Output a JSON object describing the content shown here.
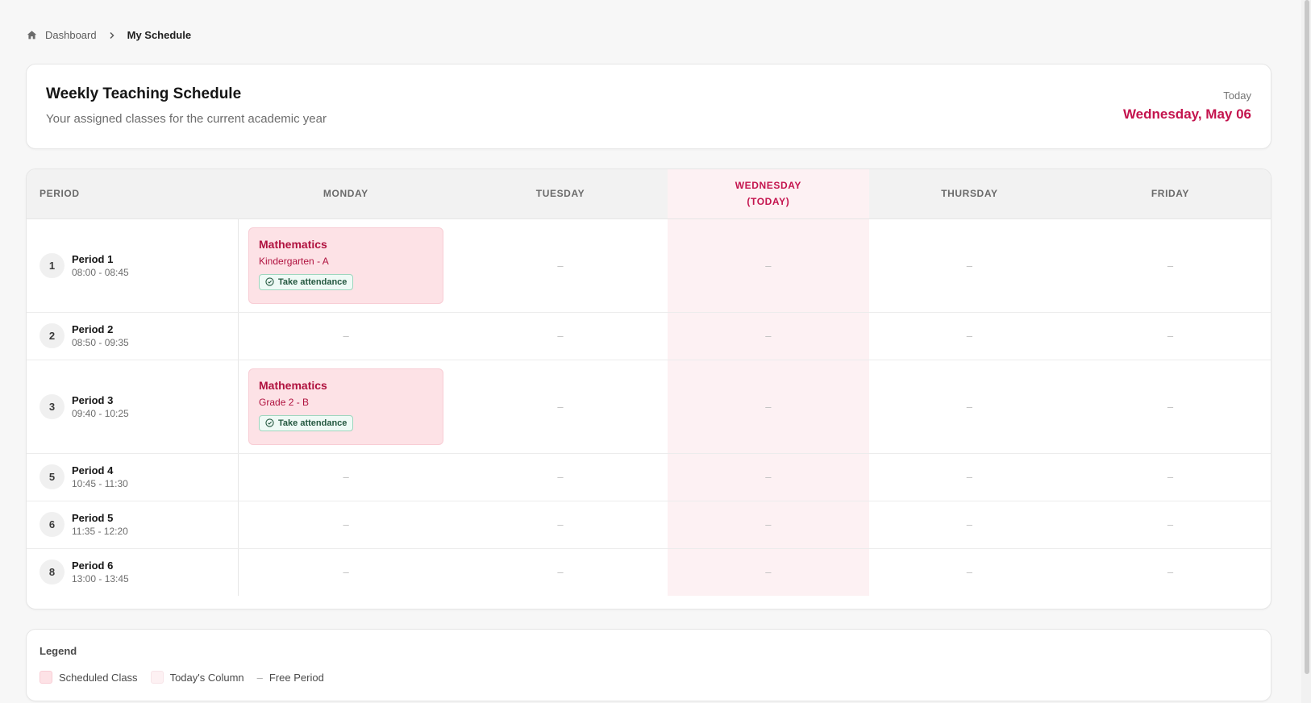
{
  "breadcrumb": {
    "home_label": "Dashboard",
    "current": "My Schedule"
  },
  "header": {
    "title": "Weekly Teaching Schedule",
    "subtitle": "Your assigned classes for the current academic year",
    "today_label": "Today",
    "today_date": "Wednesday, May 06"
  },
  "table": {
    "period_header": "PERIOD",
    "days": [
      {
        "label": "MONDAY",
        "sub": ""
      },
      {
        "label": "TUESDAY",
        "sub": ""
      },
      {
        "label": "WEDNESDAY",
        "sub": "(TODAY)"
      },
      {
        "label": "THURSDAY",
        "sub": ""
      },
      {
        "label": "FRIDAY",
        "sub": ""
      }
    ],
    "free_marker": "–",
    "attendance_label": "Take attendance",
    "rows": [
      {
        "num": "1",
        "name": "Period 1",
        "time": "08:00 - 08:45",
        "monday": {
          "subject": "Mathematics",
          "grade": "Kindergarten - A"
        }
      },
      {
        "num": "2",
        "name": "Period 2",
        "time": "08:50 - 09:35"
      },
      {
        "num": "3",
        "name": "Period 3",
        "time": "09:40 - 10:25",
        "monday": {
          "subject": "Mathematics",
          "grade": "Grade 2 - B"
        }
      },
      {
        "num": "5",
        "name": "Period 4",
        "time": "10:45 - 11:30"
      },
      {
        "num": "6",
        "name": "Period 5",
        "time": "11:35 - 12:20"
      },
      {
        "num": "8",
        "name": "Period 6",
        "time": "13:00 - 13:45"
      }
    ]
  },
  "legend": {
    "title": "Legend",
    "scheduled": "Scheduled Class",
    "today_column": "Today's Column",
    "free_marker": "–",
    "free_period": "Free Period"
  },
  "colors": {
    "accent": "#c4144e",
    "scheduled_bg": "#fde2e6",
    "today_bg": "#fdf1f3",
    "attendance_bg": "#effaf6"
  }
}
